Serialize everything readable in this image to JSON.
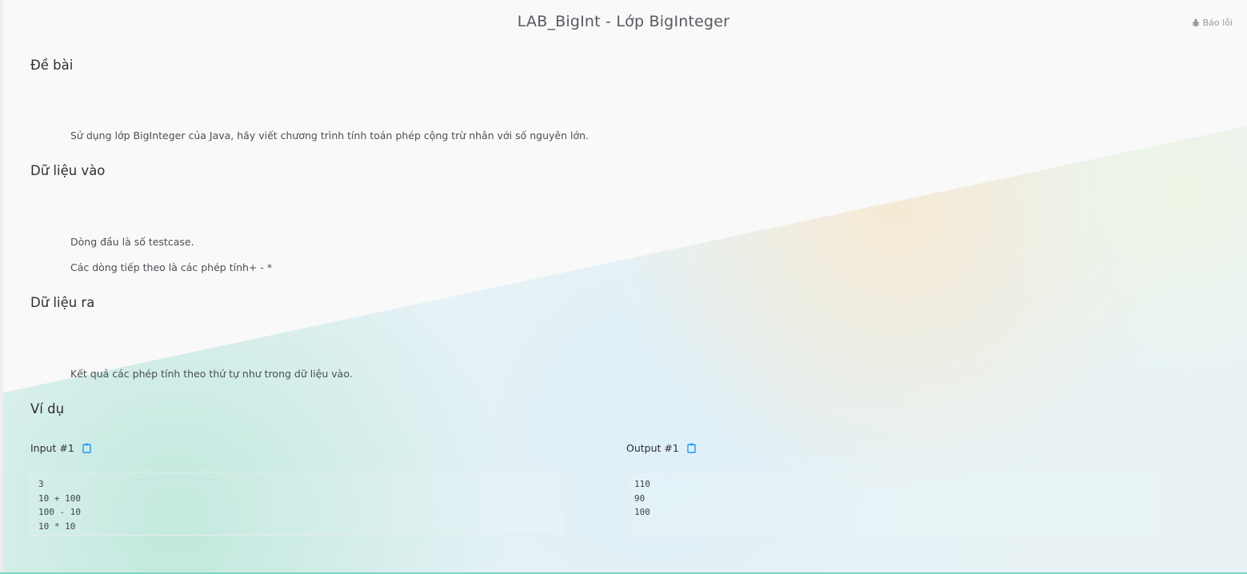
{
  "header": {
    "title": "LAB_BigInt - Lớp BigInteger",
    "report_label": "Báo lỗi",
    "report_icon": "bug-icon"
  },
  "sections": {
    "problem": {
      "heading": "Đề bài",
      "text": "Sử dụng lớp BigInteger của Java, hãy viết chương trình tính toán phép cộng trừ nhân với số nguyên lớn."
    },
    "input": {
      "heading": "Dữ liệu vào",
      "lines": [
        "Dòng đầu là số testcase.",
        "Các dòng tiếp theo là các phép tính+ - *"
      ]
    },
    "output": {
      "heading": "Dữ liệu ra",
      "text": "Kết quả các phép tính theo thứ tự như trong dữ liệu vào."
    },
    "examples": {
      "heading": "Ví dụ",
      "input_label": "Input #1",
      "output_label": "Output #1",
      "copy_icon": "clipboard-icon",
      "input_lines": [
        "3",
        "10 + 100",
        "100 - 10",
        "10 * 10"
      ],
      "output_lines": [
        "110",
        "90",
        "100"
      ]
    }
  },
  "colors": {
    "accent_copy": "#2196f3",
    "bottom_accent": "#7fd6c2"
  }
}
